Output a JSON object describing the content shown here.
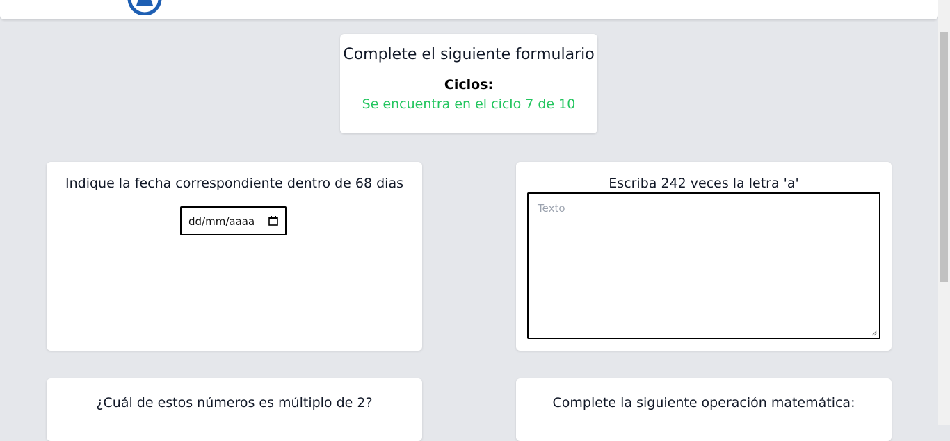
{
  "header": {
    "title": "Complete el siguiente formulario",
    "cycles_label": "Ciclos:",
    "cycle_status": "Se encuentra en el ciclo 7 de 10"
  },
  "colors": {
    "background": "#e5e7eb",
    "card": "#ffffff",
    "success_text": "#22c55e",
    "logo_blue": "#1e5fb3"
  },
  "questions": [
    {
      "prompt": "Indique la fecha correspondiente dentro de 68 dias",
      "input_type": "date",
      "placeholder": "dd/mm/aaaa"
    },
    {
      "prompt": "Escriba 242 veces la letra 'a'",
      "input_type": "textarea",
      "placeholder": "Texto"
    },
    {
      "prompt": "¿Cuál de estos números es múltiplo de 2?"
    },
    {
      "prompt": "Complete la siguiente operación matemática:"
    }
  ],
  "icons": {
    "calendar": "calendar-icon",
    "logo": "logo-icon",
    "resize": "resize-grip-icon"
  }
}
